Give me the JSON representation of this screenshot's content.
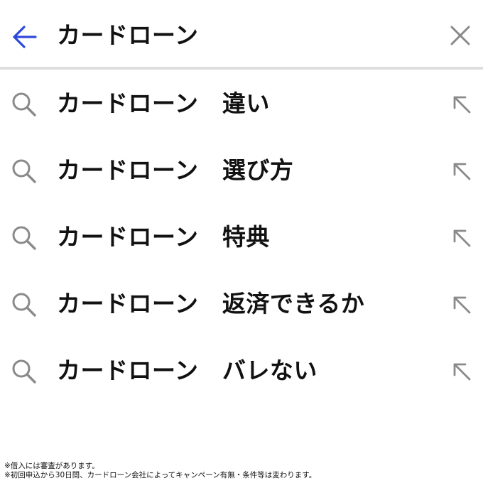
{
  "search": {
    "query": "カードローン",
    "back_icon": "arrow-left-icon",
    "clear_icon": "close-icon",
    "accent_color": "#2e49d8",
    "icon_color": "#8a8a8a"
  },
  "suggestions": [
    {
      "label": "カードローン　違い",
      "icon": "search-icon",
      "action_icon": "arrow-up-left-icon"
    },
    {
      "label": "カードローン　選び方",
      "icon": "search-icon",
      "action_icon": "arrow-up-left-icon"
    },
    {
      "label": "カードローン　特典",
      "icon": "search-icon",
      "action_icon": "arrow-up-left-icon"
    },
    {
      "label": "カードローン　返済できるか",
      "icon": "search-icon",
      "action_icon": "arrow-up-left-icon"
    },
    {
      "label": "カードローン　バレない",
      "icon": "search-icon",
      "action_icon": "arrow-up-left-icon"
    }
  ],
  "footnotes": [
    "※借入には審査があります。",
    "※初回申込から30日間、カードローン会社によってキャンペーン有無・条件等は変わります。"
  ]
}
